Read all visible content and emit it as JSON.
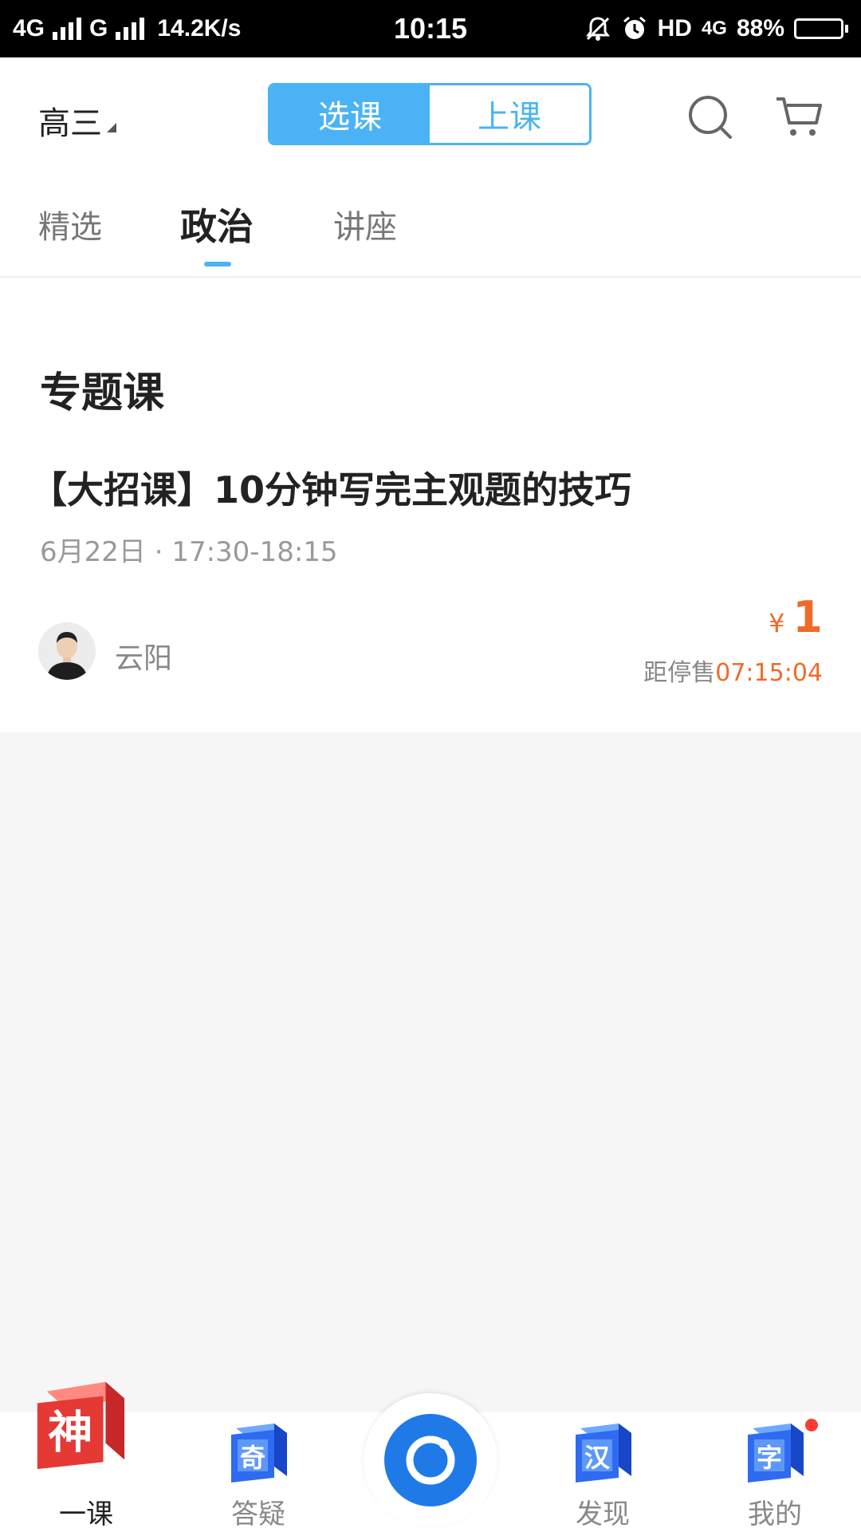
{
  "status_bar": {
    "network1": "4G",
    "network2": "G",
    "speed": "14.2K/s",
    "time": "10:15",
    "hd": "HD",
    "lte": "4G",
    "battery": "88%",
    "battery_level": 0.88,
    "icons": [
      "signal-bars-icon",
      "bell-off-icon",
      "alarm-clock-icon",
      "battery-icon"
    ]
  },
  "header": {
    "grade": "高三",
    "segment": {
      "left": "选课",
      "right": "上课",
      "active": "left"
    },
    "icons": [
      "search-icon",
      "cart-icon"
    ]
  },
  "tabs": [
    {
      "label": "精选",
      "active": false
    },
    {
      "label": "政治",
      "active": true
    },
    {
      "label": "讲座",
      "active": false
    }
  ],
  "content": {
    "section_title": "专题课",
    "course": {
      "title": "【大招课】10分钟写完主观题的技巧",
      "time": "6月22日 · 17:30-18:15",
      "teacher": "云阳",
      "price_currency": "¥",
      "price_value": "1",
      "countdown_prefix": "距停售",
      "countdown_time": "07:15:04"
    }
  },
  "bottom_nav": {
    "items": [
      {
        "icon_char": "神",
        "label": "一课",
        "active": true
      },
      {
        "icon_char": "奇",
        "label": "答疑",
        "active": false
      },
      {
        "icon_char": "汉",
        "label": "发现",
        "active": false
      },
      {
        "icon_char": "字",
        "label": "我的",
        "active": false,
        "badge": true
      }
    ],
    "camera_icon": "camera-icon"
  },
  "colors": {
    "accent": "#4bb3f5",
    "price": "#f06a2a",
    "camera": "#1f7ae8",
    "badge": "#ff3b30"
  }
}
